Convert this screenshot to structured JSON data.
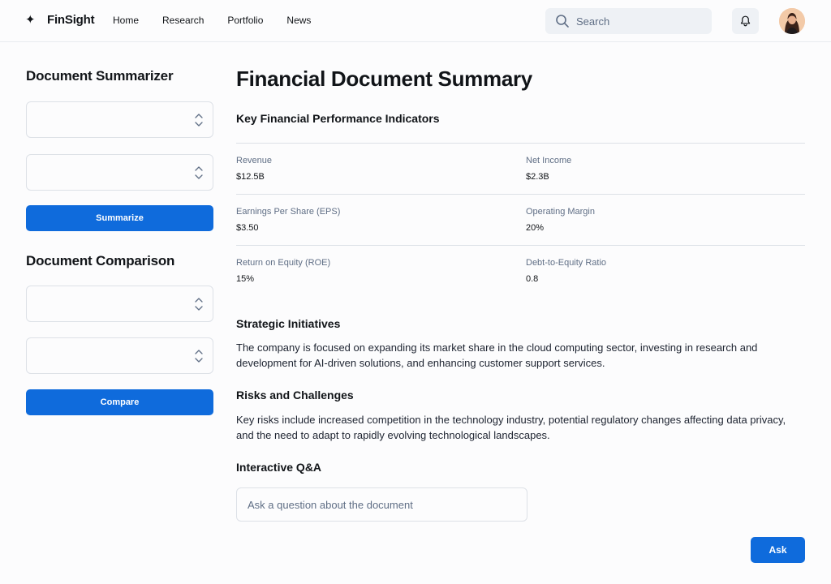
{
  "header": {
    "brand": "FinSight",
    "nav": [
      "Home",
      "Research",
      "Portfolio",
      "News"
    ],
    "search_placeholder": "Search",
    "icons": {
      "logo": "sparkle-icon",
      "search": "search-icon",
      "notifications": "bell-icon"
    }
  },
  "sidebar": {
    "summarizer_title": "Document Summarizer",
    "summarize_label": "Summarize",
    "comparison_title": "Document Comparison",
    "compare_label": "Compare"
  },
  "main": {
    "title": "Financial Document Summary",
    "kpi_heading": "Key Financial Performance Indicators",
    "kpis": [
      {
        "label": "Revenue",
        "value": "$12.5B"
      },
      {
        "label": "Net Income",
        "value": "$2.3B"
      },
      {
        "label": "Earnings Per Share (EPS)",
        "value": "$3.50"
      },
      {
        "label": "Operating Margin",
        "value": "20%"
      },
      {
        "label": "Return on Equity (ROE)",
        "value": "15%"
      },
      {
        "label": "Debt-to-Equity Ratio",
        "value": "0.8"
      }
    ],
    "strategic_heading": "Strategic Initiatives",
    "strategic_text": "The company is focused on expanding its market share in the cloud computing sector, investing in research and development for AI-driven solutions, and enhancing customer support services.",
    "risks_heading": "Risks and Challenges",
    "risks_text": "Key risks include increased competition in the technology industry, potential regulatory changes affecting data privacy, and the need to adapt to rapidly evolving technological landscapes.",
    "qa_heading": "Interactive Q&A",
    "qa_placeholder": "Ask a question about the document",
    "ask_label": "Ask"
  },
  "colors": {
    "primary": "#0f6bdc",
    "muted_text": "#5f6e85",
    "border": "#dde1e7",
    "chip_bg": "#eef1f5"
  }
}
